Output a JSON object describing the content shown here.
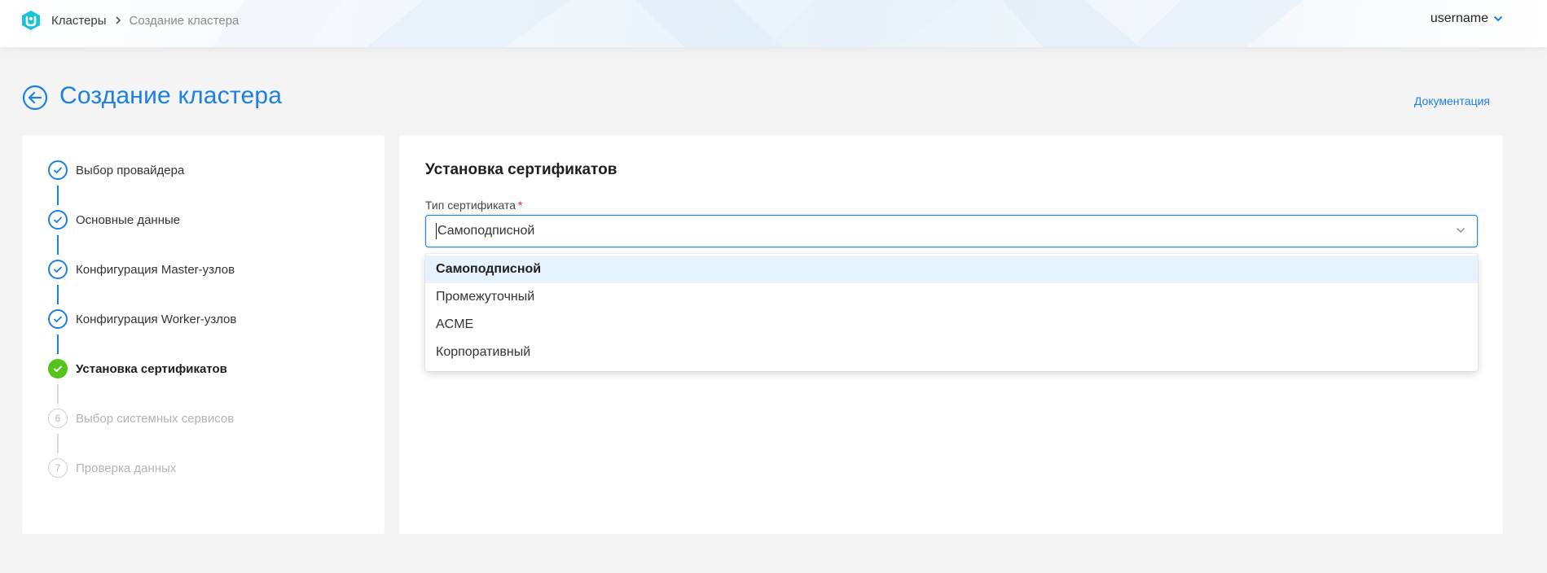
{
  "header": {
    "breadcrumbs": [
      "Кластеры",
      "Создание кластера"
    ],
    "username": "username",
    "logo_icon": "shield-logo-icon",
    "brand_color": "#1b7fe3"
  },
  "page": {
    "title": "Создание кластера",
    "docs_link": "Документация",
    "back_icon": "arrow-left-circle-icon"
  },
  "steps": [
    {
      "label": "Выбор провайдера",
      "status": "done"
    },
    {
      "label": "Основные данные",
      "status": "done"
    },
    {
      "label": "Конфигурация Master-узлов",
      "status": "done"
    },
    {
      "label": "Конфигурация Worker-узлов",
      "status": "done"
    },
    {
      "label": "Установка сертификатов",
      "status": "active"
    },
    {
      "label": "Выбор системных сервисов",
      "status": "pending",
      "number": "6"
    },
    {
      "label": "Проверка данных",
      "status": "pending",
      "number": "7"
    }
  ],
  "form": {
    "section_title": "Установка сертификатов",
    "field_label": "Тип сертификата",
    "required_mark": "*",
    "selected_value": "Самоподписной",
    "options": [
      "Самоподписной",
      "Промежуточный",
      "ACME",
      "Корпоративный"
    ],
    "highlighted_option_index": 0
  },
  "colors": {
    "accent": "#1b7fe3",
    "success": "#52c41a",
    "required": "#e02424",
    "option_highlight": "#e6f3ff"
  }
}
